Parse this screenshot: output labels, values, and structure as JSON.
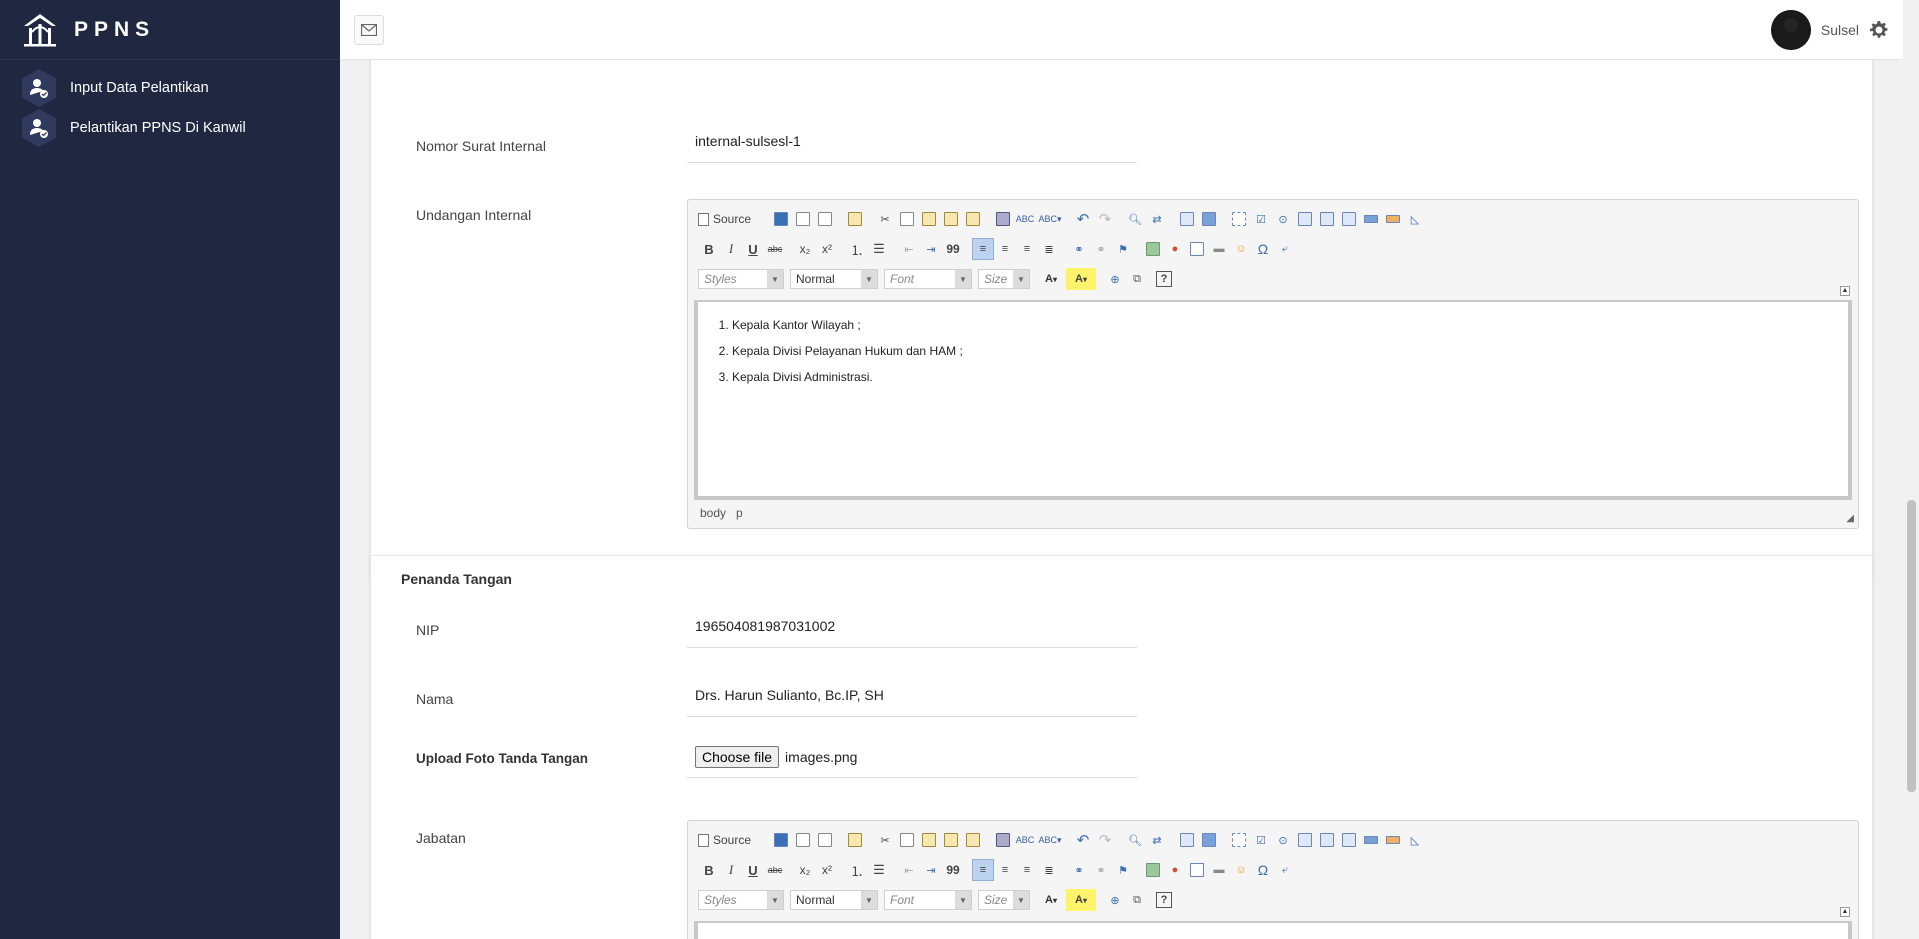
{
  "app": {
    "brand": "PPNS"
  },
  "sidebar": {
    "items": [
      {
        "label": "Input Data Pelantikan",
        "icon": "user-check-icon"
      },
      {
        "label": "Pelantikan PPNS Di Kanwil",
        "icon": "user-check-icon"
      }
    ]
  },
  "header": {
    "user_name": "Sulsel"
  },
  "form": {
    "nomor_surat": {
      "label": "Nomor Surat Internal",
      "value": "internal-sulsesl-1"
    },
    "undangan": {
      "label": "Undangan Internal",
      "items": [
        "Kepala Kantor Wilayah ;",
        "Kepala Divisi Pelayanan Hukum dan HAM ;",
        "Kepala Divisi Administrasi."
      ],
      "path": [
        "body",
        "p"
      ]
    },
    "penanda": {
      "title": "Penanda Tangan",
      "nip": {
        "label": "NIP",
        "value": "196504081987031002"
      },
      "nama": {
        "label": "Nama",
        "value": "Drs. Harun Sulianto, Bc.IP, SH"
      },
      "upload": {
        "label": "Upload Foto Tanda Tangan",
        "button": "Choose file",
        "filename": "images.png"
      },
      "jabatan": {
        "label": "Jabatan"
      }
    }
  },
  "editor": {
    "source_label": "Source",
    "styles_placeholder": "Styles",
    "format_value": "Normal",
    "font_placeholder": "Font",
    "size_placeholder": "Size",
    "bold": "B",
    "italic": "I",
    "underline": "U",
    "strike": "abc",
    "sub": "x₂",
    "sup": "x²",
    "blockquote": "99",
    "help": "?",
    "omega": "Ω"
  },
  "colors": {
    "sidebar_bg": "#1f2741",
    "accent": "#3a6fb5"
  }
}
